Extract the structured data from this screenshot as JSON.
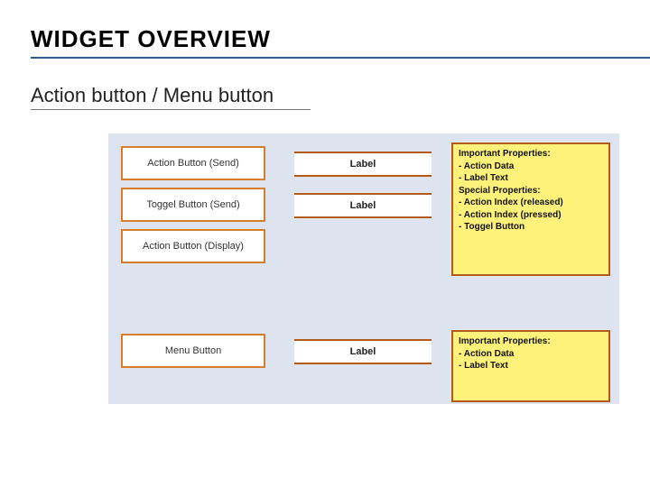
{
  "title": "WIDGET OVERVIEW",
  "subtitle": "Action button / Menu button",
  "buttons": {
    "action_send": "Action Button (Send)",
    "toggle_send": "Toggel Button (Send)",
    "action_display": "Action Button (Display)",
    "menu": "Menu Button"
  },
  "labels": {
    "l1": "Label",
    "l2": "Label",
    "l3": "Label"
  },
  "panels": {
    "p1": {
      "t0": "Important Properties:",
      "t1": "- Action Data",
      "t2": "- Label Text",
      "t3": "Special Properties:",
      "t4": "- Action Index (released)",
      "t5": "- Action Index (pressed)",
      "t6": "- Toggel Button"
    },
    "p2": {
      "t0": "Important Properties:",
      "t1": "- Action Data",
      "t2": "- Label Text"
    }
  }
}
